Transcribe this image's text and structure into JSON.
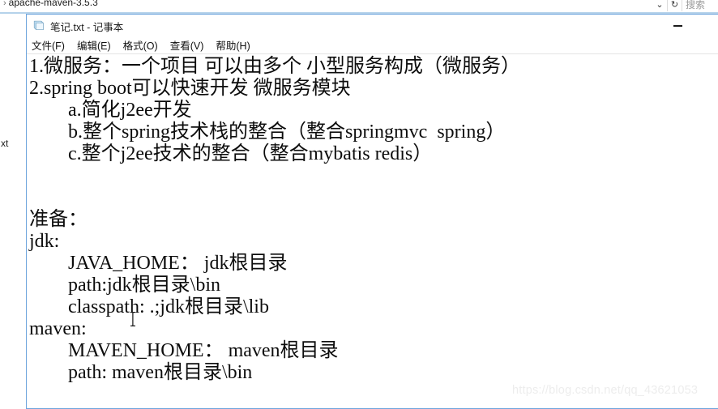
{
  "explorer": {
    "breadcrumb_separator": "›",
    "breadcrumb_label": "apache-maven-3.5.3",
    "chevron_icon": "⌄",
    "refresh_icon": "↻",
    "search_placeholder": "搜索",
    "file_item_label": "xt"
  },
  "notepad": {
    "title": "笔记.txt - 记事本",
    "icon_name": "notepad-document-icon",
    "minimize_label": "—",
    "menu": [
      {
        "label": "文件(F)"
      },
      {
        "label": "编辑(E)"
      },
      {
        "label": "格式(O)"
      },
      {
        "label": "查看(V)"
      },
      {
        "label": "帮助(H)"
      }
    ],
    "document_lines": [
      "1.微服务：一个项目 可以由多个 小型服务构成（微服务）",
      "2.spring boot可以快速开发 微服务模块",
      "        a.简化j2ee开发",
      "        b.整个spring技术栈的整合（整合springmvc  spring）",
      "        c.整个j2ee技术的整合（整合mybatis redis）",
      "",
      "",
      "准备：",
      "jdk:",
      "        JAVA_HOME： jdk根目录",
      "        path:jdk根目录\\bin",
      "        classpath: .;jdk根目录\\lib",
      "maven:",
      "        MAVEN_HOME： maven根目录",
      "        path: maven根目录\\bin"
    ]
  },
  "watermark": {
    "text": "https://blog.csdn.net/qq_43621053"
  },
  "colors": {
    "window_border": "#6ea5dd",
    "explorer_accent": "#b5d2ea",
    "text": "#0d0d0d",
    "watermark": "#ededed"
  }
}
